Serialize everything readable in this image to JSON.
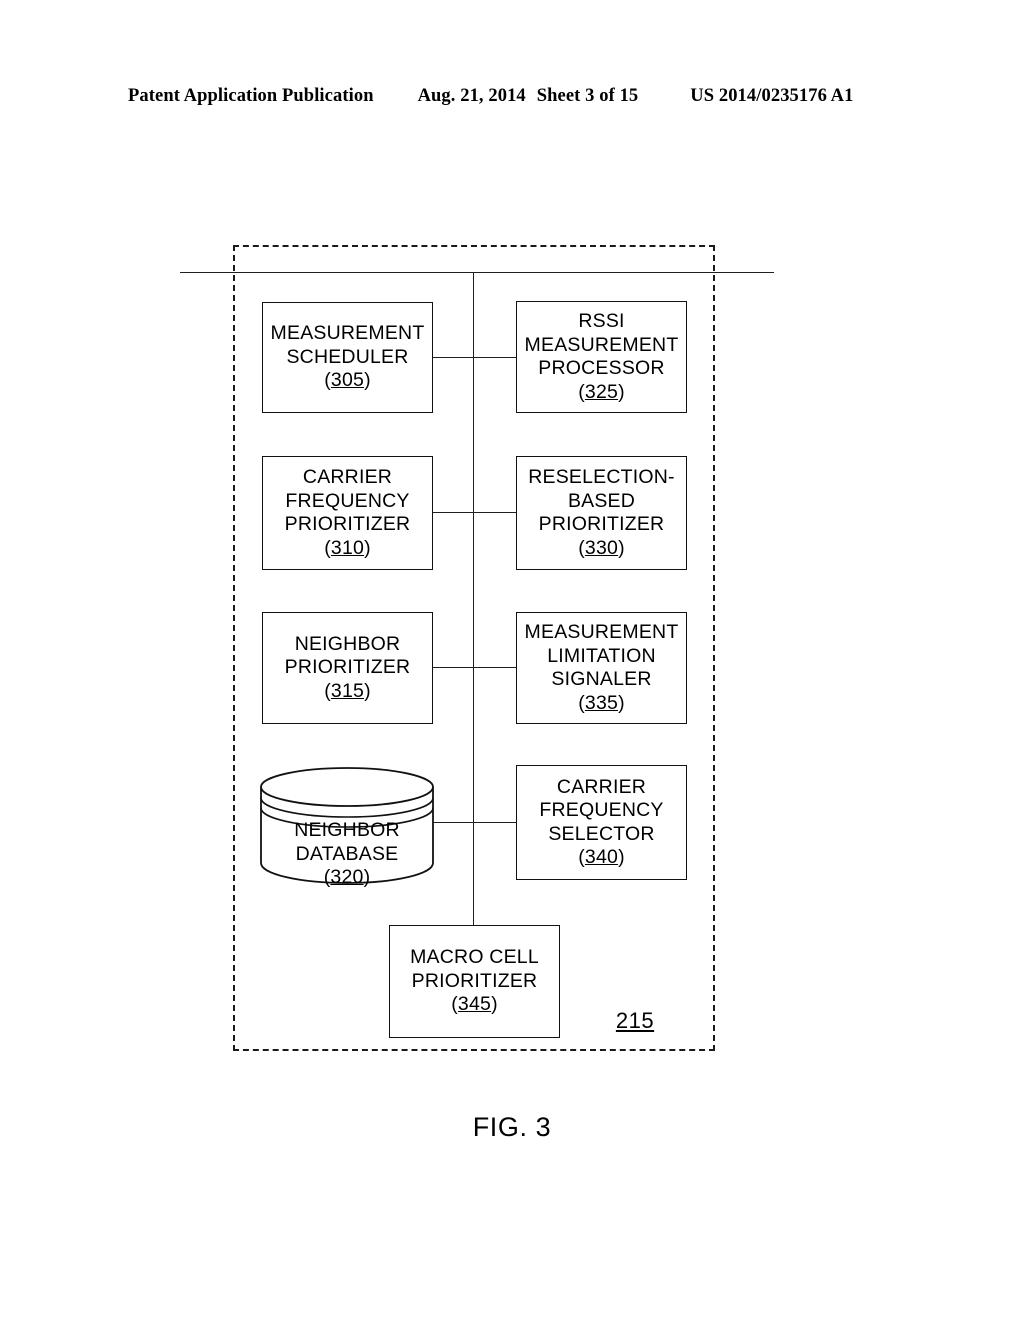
{
  "header": {
    "publication": "Patent Application Publication",
    "date": "Aug. 21, 2014",
    "sheet": "Sheet 3 of 15",
    "document_number": "US 2014/0235176 A1"
  },
  "figure": {
    "caption": "FIG. 3",
    "container_ref": "215",
    "modules": {
      "m305": {
        "line1": "MEASUREMENT",
        "line2": "SCHEDULER",
        "ref_open": "(",
        "ref_num": "305",
        "ref_close": ")"
      },
      "m310": {
        "line1": "CARRIER",
        "line2": "FREQUENCY",
        "line3": "PRIORITIZER",
        "ref_open": "(",
        "ref_num": "310",
        "ref_close": ")"
      },
      "m315": {
        "line1": "NEIGHBOR",
        "line2": "PRIORITIZER",
        "ref_open": "(",
        "ref_num": "315",
        "ref_close": ")"
      },
      "m320": {
        "line1": "NEIGHBOR",
        "line2": "DATABASE",
        "ref_open": "(",
        "ref_num": "320",
        "ref_close": ")"
      },
      "m325": {
        "line1": "RSSI",
        "line2": "MEASUREMENT",
        "line3": "PROCESSOR",
        "ref_open": "(",
        "ref_num": "325",
        "ref_close": ")"
      },
      "m330": {
        "line1": "RESELECTION-",
        "line2": "BASED",
        "line3": "PRIORITIZER",
        "ref_open": "(",
        "ref_num": "330",
        "ref_close": ")"
      },
      "m335": {
        "line1": "MEASUREMENT",
        "line2": "LIMITATION",
        "line3": "SIGNALER",
        "ref_open": "(",
        "ref_num": "335",
        "ref_close": ")"
      },
      "m340": {
        "line1": "CARRIER",
        "line2": "FREQUENCY",
        "line3": "SELECTOR",
        "ref_open": "(",
        "ref_num": "340",
        "ref_close": ")"
      },
      "m345": {
        "line1": "MACRO CELL",
        "line2": "PRIORITIZER",
        "ref_open": "(",
        "ref_num": "345",
        "ref_close": ")"
      }
    }
  },
  "colors": {
    "ink": "#000000",
    "line": "#202020",
    "page": "#ffffff"
  }
}
